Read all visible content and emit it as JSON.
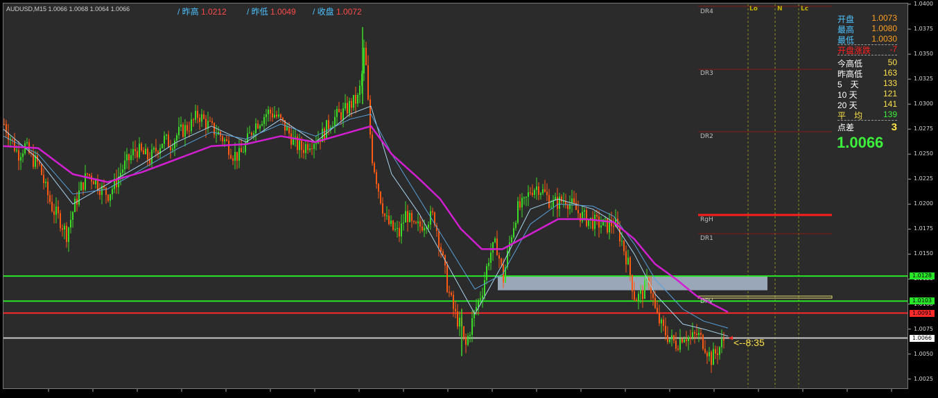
{
  "header": {
    "symbol_line": "AUDUSD,M15  1.0066 1.0068 1.0064 1.0066",
    "prev_high_label": "/ 昨高",
    "prev_high_value": "1.0212",
    "prev_low_label": "/ 昨低",
    "prev_low_value": "1.0049",
    "prev_close_label": "/ 收盘",
    "prev_close_value": "1.0072"
  },
  "colors": {
    "background": "#2b2b2b",
    "bull_candle": "#3cdc28",
    "bear_candle": "#ff5a14",
    "ma_fast": "#a9d3ee",
    "ma_mid": "#5aa0d8",
    "ma_slow": "#d21fd2",
    "green_level": "#28e628",
    "red_level": "#ff2a2a",
    "current_price": "#c8c8c8",
    "pivot_zone": "#9aa7b8"
  },
  "stats_panel": {
    "rows": [
      {
        "label": "开盘",
        "value": "1.0073",
        "color": "#ffa020"
      },
      {
        "label": "最高",
        "value": "1.0080",
        "color": "#ffa020"
      },
      {
        "label": "最低",
        "value": "1.0030",
        "color": "#ffa020"
      },
      {
        "label": "开盘涨跌",
        "value": "-7",
        "color": "#ff2020"
      },
      {
        "label": "今高低",
        "value": "50",
        "color": "#ffe24a"
      },
      {
        "label": "昨高低",
        "value": "163",
        "color": "#ffe24a"
      },
      {
        "label": "5　天",
        "value": "133",
        "color": "#ffe24a"
      },
      {
        "label": "10 天",
        "value": "121",
        "color": "#ffe24a"
      },
      {
        "label": "20 天",
        "value": "141",
        "color": "#ffe24a"
      },
      {
        "label": "平　均",
        "value": "139",
        "color": "#3cf03c"
      },
      {
        "label": "点差",
        "value": "3",
        "color": "#ffe24a"
      }
    ],
    "last_price": "1.0066"
  },
  "levels": {
    "dr4": "DR4",
    "dr3": "DR3",
    "dr2": "DR2",
    "rgh": "RgH",
    "dr1": "DR1",
    "dpv": "DPV",
    "lo": "Lo",
    "n": "N",
    "lc": "Lc"
  },
  "countdown": "<--8:35",
  "chart_data": {
    "type": "candlestick",
    "symbol": "AUDUSD",
    "timeframe": "M15",
    "ylim": [
      1.0022,
      1.04
    ],
    "yticks": [
      "1.0400",
      "1.0375",
      "1.0350",
      "1.0325",
      "1.0300",
      "1.0275",
      "1.0250",
      "1.0225",
      "1.0200",
      "1.0175",
      "1.0150",
      "1.0125",
      "1.0100",
      "1.0075",
      "1.0050",
      "1.0025"
    ],
    "close_path": [
      [
        0,
        1.028
      ],
      [
        10,
        1.0265
      ],
      [
        20,
        1.025
      ],
      [
        30,
        1.0258
      ],
      [
        40,
        1.0245
      ],
      [
        50,
        1.024
      ],
      [
        60,
        1.0215
      ],
      [
        70,
        1.0195
      ],
      [
        80,
        1.0185
      ],
      [
        90,
        1.017
      ],
      [
        100,
        1.0195
      ],
      [
        110,
        1.0215
      ],
      [
        120,
        1.023
      ],
      [
        130,
        1.0225
      ],
      [
        140,
        1.0215
      ],
      [
        150,
        1.021
      ],
      [
        160,
        1.022
      ],
      [
        170,
        1.0235
      ],
      [
        180,
        1.0245
      ],
      [
        190,
        1.0255
      ],
      [
        200,
        1.025
      ],
      [
        210,
        1.0245
      ],
      [
        220,
        1.0255
      ],
      [
        230,
        1.0265
      ],
      [
        240,
        1.026
      ],
      [
        250,
        1.027
      ],
      [
        260,
        1.0275
      ],
      [
        270,
        1.028
      ],
      [
        280,
        1.029
      ],
      [
        290,
        1.0282
      ],
      [
        300,
        1.0275
      ],
      [
        310,
        1.027
      ],
      [
        320,
        1.0262
      ],
      [
        330,
        1.025
      ],
      [
        340,
        1.0248
      ],
      [
        350,
        1.0262
      ],
      [
        360,
        1.0278
      ],
      [
        370,
        1.0285
      ],
      [
        380,
        1.0292
      ],
      [
        390,
        1.029
      ],
      [
        400,
        1.0282
      ],
      [
        410,
        1.0272
      ],
      [
        420,
        1.026
      ],
      [
        430,
        1.0255
      ],
      [
        440,
        1.0262
      ],
      [
        450,
        1.0265
      ],
      [
        460,
        1.027
      ],
      [
        470,
        1.0282
      ],
      [
        480,
        1.0288
      ],
      [
        490,
        1.0292
      ],
      [
        500,
        1.03
      ],
      [
        510,
        1.0305
      ],
      [
        515,
        1.0322
      ],
      [
        520,
        1.036
      ],
      [
        525,
        1.03
      ],
      [
        530,
        1.025
      ],
      [
        540,
        1.0215
      ],
      [
        550,
        1.0185
      ],
      [
        560,
        1.0175
      ],
      [
        570,
        1.017
      ],
      [
        580,
        1.0192
      ],
      [
        590,
        1.0175
      ],
      [
        600,
        1.0178
      ],
      [
        610,
        1.0185
      ],
      [
        620,
        1.0188
      ],
      [
        630,
        1.0155
      ],
      [
        640,
        1.0115
      ],
      [
        650,
        1.009
      ],
      [
        660,
        1.0075
      ],
      [
        665,
        1.0055
      ],
      [
        670,
        1.007
      ],
      [
        680,
        1.0095
      ],
      [
        690,
        1.0115
      ],
      [
        700,
        1.015
      ],
      [
        710,
        1.016
      ],
      [
        720,
        1.0125
      ],
      [
        730,
        1.0165
      ],
      [
        740,
        1.0195
      ],
      [
        750,
        1.02
      ],
      [
        760,
        1.0215
      ],
      [
        770,
        1.0218
      ],
      [
        780,
        1.021
      ],
      [
        790,
        1.02
      ],
      [
        800,
        1.0202
      ],
      [
        810,
        1.0205
      ],
      [
        820,
        1.0198
      ],
      [
        830,
        1.019
      ],
      [
        840,
        1.0185
      ],
      [
        850,
        1.0182
      ],
      [
        860,
        1.018
      ],
      [
        870,
        1.0178
      ],
      [
        880,
        1.0182
      ],
      [
        890,
        1.0165
      ],
      [
        900,
        1.014
      ],
      [
        910,
        1.0105
      ],
      [
        920,
        1.011
      ],
      [
        930,
        1.0125
      ],
      [
        940,
        1.009
      ],
      [
        950,
        1.0075
      ],
      [
        960,
        1.0065
      ],
      [
        970,
        1.006
      ],
      [
        980,
        1.007
      ],
      [
        990,
        1.0065
      ],
      [
        1000,
        1.007
      ],
      [
        1010,
        1.006
      ],
      [
        1020,
        1.0045
      ],
      [
        1030,
        1.0055
      ],
      [
        1040,
        1.0066
      ]
    ],
    "ma_fast": [
      [
        0,
        1.0275
      ],
      [
        50,
        1.0245
      ],
      [
        100,
        1.02
      ],
      [
        150,
        1.022
      ],
      [
        200,
        1.024
      ],
      [
        250,
        1.0262
      ],
      [
        300,
        1.0278
      ],
      [
        350,
        1.0262
      ],
      [
        400,
        1.0285
      ],
      [
        450,
        1.0262
      ],
      [
        500,
        1.029
      ],
      [
        530,
        1.0298
      ],
      [
        560,
        1.023
      ],
      [
        600,
        1.019
      ],
      [
        640,
        1.014
      ],
      [
        680,
        1.009
      ],
      [
        720,
        1.014
      ],
      [
        760,
        1.0195
      ],
      [
        800,
        1.0205
      ],
      [
        850,
        1.0195
      ],
      [
        880,
        1.0182
      ],
      [
        910,
        1.015
      ],
      [
        940,
        1.011
      ],
      [
        980,
        1.008
      ],
      [
        1010,
        1.0075
      ],
      [
        1045,
        1.0068
      ]
    ],
    "ma_mid": [
      [
        0,
        1.0268
      ],
      [
        50,
        1.025
      ],
      [
        100,
        1.021
      ],
      [
        150,
        1.0215
      ],
      [
        200,
        1.0235
      ],
      [
        250,
        1.0255
      ],
      [
        300,
        1.0272
      ],
      [
        350,
        1.0265
      ],
      [
        400,
        1.028
      ],
      [
        450,
        1.0268
      ],
      [
        500,
        1.0285
      ],
      [
        530,
        1.029
      ],
      [
        560,
        1.025
      ],
      [
        600,
        1.0205
      ],
      [
        640,
        1.016
      ],
      [
        680,
        1.0115
      ],
      [
        720,
        1.013
      ],
      [
        760,
        1.018
      ],
      [
        800,
        1.02
      ],
      [
        850,
        1.0198
      ],
      [
        880,
        1.0188
      ],
      [
        910,
        1.016
      ],
      [
        940,
        1.0125
      ],
      [
        980,
        1.0095
      ],
      [
        1010,
        1.0083
      ],
      [
        1045,
        1.0076
      ]
    ],
    "ma_slow": [
      [
        0,
        1.0258
      ],
      [
        50,
        1.0256
      ],
      [
        100,
        1.023
      ],
      [
        150,
        1.0222
      ],
      [
        200,
        1.0232
      ],
      [
        250,
        1.0245
      ],
      [
        300,
        1.0258
      ],
      [
        350,
        1.026
      ],
      [
        400,
        1.0268
      ],
      [
        450,
        1.0262
      ],
      [
        500,
        1.0272
      ],
      [
        530,
        1.0278
      ],
      [
        560,
        1.025
      ],
      [
        600,
        1.0225
      ],
      [
        630,
        1.0205
      ],
      [
        660,
        1.0175
      ],
      [
        690,
        1.0155
      ],
      [
        720,
        1.0155
      ],
      [
        760,
        1.017
      ],
      [
        800,
        1.0185
      ],
      [
        840,
        1.0185
      ],
      [
        880,
        1.0182
      ],
      [
        910,
        1.0165
      ],
      [
        940,
        1.014
      ],
      [
        970,
        1.0125
      ],
      [
        1000,
        1.0108
      ],
      [
        1045,
        1.0092
      ]
    ],
    "horizontal_levels": [
      {
        "name": "1.0128",
        "price": 1.0128,
        "color": "#28e628",
        "label_bg": "#28e628",
        "label_fg": "#000000"
      },
      {
        "name": "1.0103",
        "price": 1.0103,
        "color": "#28e628",
        "label_bg": "#28e628",
        "label_fg": "#000000"
      },
      {
        "name": "1.0091",
        "price": 1.0091,
        "color": "#ff2a2a",
        "label_bg": "#ff2a2a",
        "label_fg": "#000000"
      },
      {
        "name": "1.0066",
        "price": 1.0066,
        "color": "#c8c8c8",
        "label_bg": "#ffffff",
        "label_fg": "#000000"
      }
    ]
  }
}
